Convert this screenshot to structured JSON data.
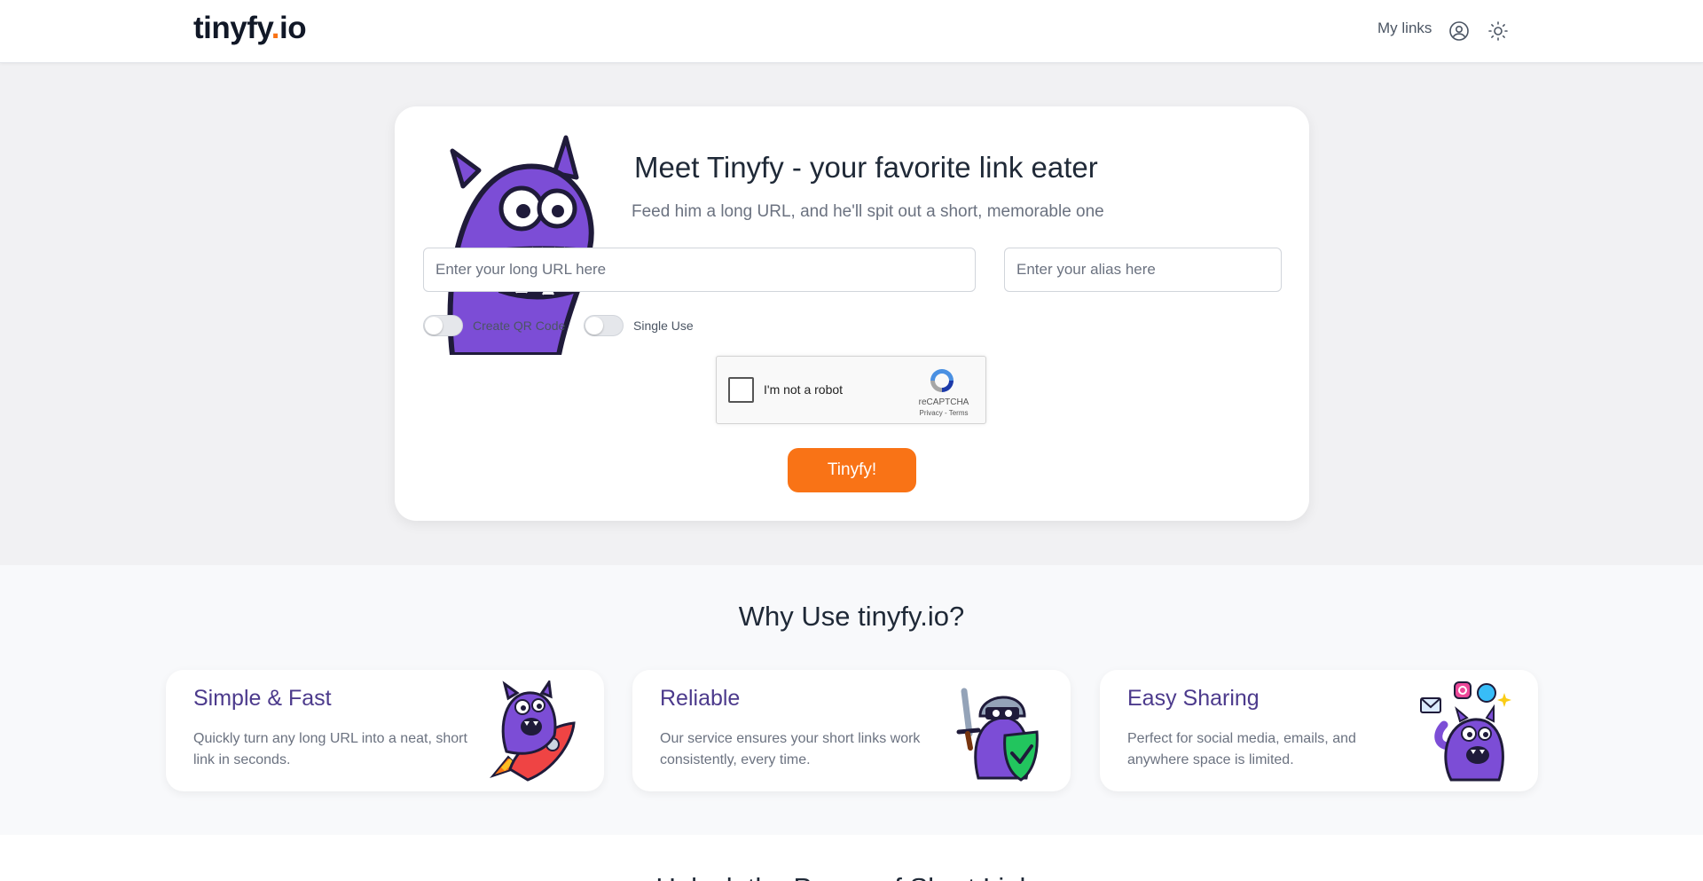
{
  "header": {
    "logo_main": "tinyfy",
    "logo_dot": ".",
    "logo_tld": "io",
    "nav_my_links": "My links",
    "icons": [
      "user-circle-icon",
      "sun-icon"
    ]
  },
  "hero": {
    "title": "Meet Tinyfy - your favorite link eater",
    "subtitle": "Feed him a long URL, and he'll spit out a short, memorable one",
    "url_placeholder": "Enter your long URL here",
    "url_value": "",
    "alias_placeholder": "Enter your alias here",
    "alias_value": "",
    "toggles": [
      {
        "label": "Create QR Code",
        "on": false
      },
      {
        "label": "Single Use",
        "on": false
      }
    ],
    "captcha": {
      "label": "I'm not a robot",
      "brand": "reCAPTCHA",
      "terms": "Privacy - Terms",
      "checked": false
    },
    "submit_label": "Tinyfy!"
  },
  "why": {
    "title": "Why Use tinyfy.io?",
    "features": [
      {
        "title": "Simple & Fast",
        "desc": "Quickly turn any long URL into a neat, short link in seconds.",
        "icon": "monster-rocket-illustration"
      },
      {
        "title": "Reliable",
        "desc": "Our service ensures your short links work consistently, every time.",
        "icon": "monster-knight-shield-illustration"
      },
      {
        "title": "Easy Sharing",
        "desc": "Perfect for social media, emails, and anywhere space is limited.",
        "icon": "monster-sharing-illustration"
      }
    ]
  },
  "next_section": {
    "title": "Unlock the Power of Short Links"
  },
  "colors": {
    "accent": "#f97316",
    "feature_title": "#4c3a8c",
    "monster_purple": "#7c4dd6"
  }
}
